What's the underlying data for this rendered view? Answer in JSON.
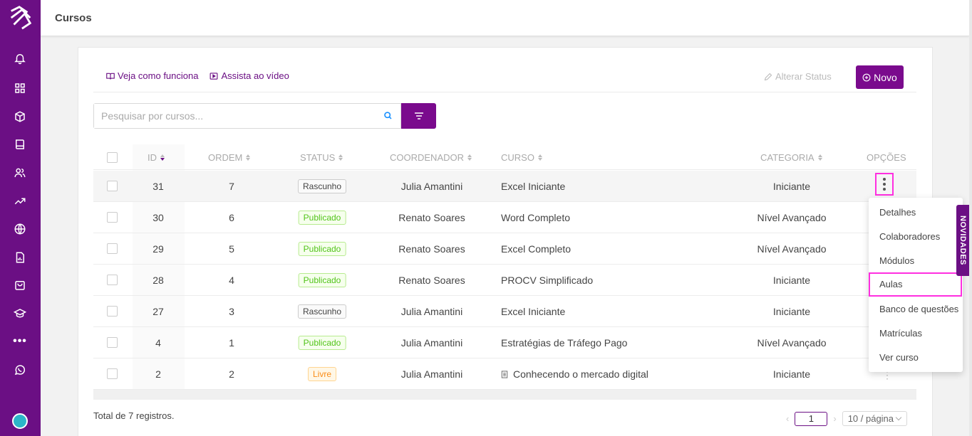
{
  "sidebar": {
    "icons": [
      "bell-icon",
      "grid-icon",
      "cube-icon",
      "book-icon",
      "users-icon",
      "trending-icon",
      "globe-icon",
      "report-icon",
      "bag-icon",
      "graduation-icon",
      "more-icon",
      "whatsapp-icon"
    ],
    "more_label": "•••"
  },
  "header": {
    "title": "Cursos"
  },
  "toolbar": {
    "link_how": "Veja como funciona",
    "link_video": "Assista ao vídeo",
    "alterar_status": "Alterar Status",
    "novo": "Novo"
  },
  "search": {
    "placeholder": "Pesquisar por cursos..."
  },
  "table": {
    "headers": {
      "id": "ID",
      "ordem": "ORDEM",
      "status": "STATUS",
      "coordenador": "COORDENADOR",
      "curso": "CURSO",
      "categoria": "CATEGORIA",
      "opcoes": "OPÇÕES"
    },
    "rows": [
      {
        "id": "31",
        "ordem": "7",
        "status": "Rascunho",
        "status_type": "rascunho",
        "coordenador": "Julia Amantini",
        "curso": "Excel Iniciante",
        "categoria": "Iniciante"
      },
      {
        "id": "30",
        "ordem": "6",
        "status": "Publicado",
        "status_type": "publicado",
        "coordenador": "Renato Soares",
        "curso": "Word Completo",
        "categoria": "Nível Avançado"
      },
      {
        "id": "29",
        "ordem": "5",
        "status": "Publicado",
        "status_type": "publicado",
        "coordenador": "Renato Soares",
        "curso": "Excel Completo",
        "categoria": "Nível Avançado"
      },
      {
        "id": "28",
        "ordem": "4",
        "status": "Publicado",
        "status_type": "publicado",
        "coordenador": "Renato Soares",
        "curso": "PROCV Simplificado",
        "categoria": "Iniciante"
      },
      {
        "id": "27",
        "ordem": "3",
        "status": "Rascunho",
        "status_type": "rascunho",
        "coordenador": "Julia Amantini",
        "curso": "Excel Iniciante",
        "categoria": "Iniciante"
      },
      {
        "id": "4",
        "ordem": "1",
        "status": "Publicado",
        "status_type": "publicado",
        "coordenador": "Julia Amantini",
        "curso": "Estratégias de Tráfego Pago",
        "categoria": "Nível Avançado"
      },
      {
        "id": "2",
        "ordem": "2",
        "status": "Livre",
        "status_type": "livre",
        "coordenador": "Julia Amantini",
        "curso": "Conhecendo o mercado digital",
        "categoria": "Iniciante"
      }
    ]
  },
  "options_menu": {
    "items": [
      "Detalhes",
      "Colaboradores",
      "Módulos",
      "Aulas",
      "Banco de questões",
      "Matrículas",
      "Ver curso"
    ],
    "selected": "Aulas"
  },
  "novidades": "NOVIDADES",
  "footer": {
    "total": "Total de 7 registros.",
    "page": "1",
    "page_size": "10 / página"
  },
  "colors": {
    "brand": "#6b0f84",
    "accent": "#7a0a8d",
    "highlight": "#ff2fe0"
  }
}
